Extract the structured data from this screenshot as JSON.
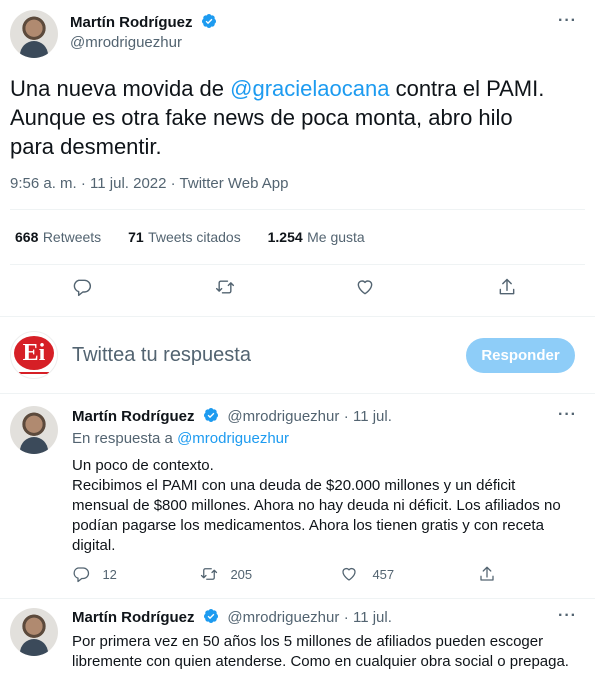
{
  "main_tweet": {
    "author_name": "Martín Rodríguez",
    "author_handle": "@mrodriguezhur",
    "text_before": "Una nueva movida de ",
    "mention": "@gracielaocana",
    "text_line1_after": " contra el PAMI.",
    "text_line2": "Aunque es otra fake news de poca monta, abro hilo",
    "text_line3": "para desmentir.",
    "meta": "9:56 a. m. · 11 jul. 2022 · Twitter Web App",
    "retweets_count": "668",
    "retweets_label": "Retweets",
    "quotes_count": "71",
    "quotes_label": "Tweets citados",
    "likes_count": "1.254",
    "likes_label": "Me gusta"
  },
  "reply_box": {
    "placeholder": "Twittea tu respuesta",
    "button_label": "Responder",
    "avatar_logo": "Ei"
  },
  "reply_1": {
    "author_name": "Martín Rodríguez",
    "author_handle": "@mrodriguezhur",
    "date": "· 11 jul.",
    "replying_prefix": "En respuesta a ",
    "replying_to": "@mrodriguezhur",
    "line1": "Un poco de contexto.",
    "line2": "Recibimos el PAMI con una deuda de $20.000 millones y un déficit",
    "line3": "mensual de $800 millones. Ahora no hay deuda ni déficit. Los afiliados no",
    "line4": "podían pagarse los medicamentos. Ahora los tienen gratis y con receta",
    "line5": "digital.",
    "replies": "12",
    "retweets": "205",
    "likes": "457"
  },
  "reply_2": {
    "author_name": "Martín Rodríguez",
    "author_handle": "@mrodriguezhur",
    "date": "· 11 jul.",
    "line1": "Por primera vez en 50 años los 5 millones de afiliados pueden escoger",
    "line2": "libremente con quien atenderse. Como en cualquier obra social o prepaga."
  },
  "colors": {
    "accent": "#1d9bf0",
    "text_primary": "#0f1419",
    "text_secondary": "#536471",
    "button_disabled": "#8ecdf8",
    "logo_red": "#d61f26"
  },
  "icons": [
    "verified-badge-icon",
    "more-icon",
    "reply-icon",
    "retweet-icon",
    "like-icon",
    "share-icon"
  ]
}
